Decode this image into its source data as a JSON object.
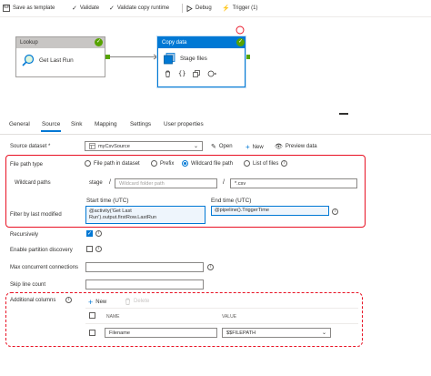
{
  "toolbar": {
    "save_template": "Save as template",
    "validate": "Validate",
    "validate_copy": "Validate copy runtime",
    "debug": "Debug",
    "trigger": "Trigger (1)"
  },
  "canvas": {
    "lookup": {
      "header": "Lookup",
      "name": "Get Last Run"
    },
    "copy": {
      "header": "Copy data",
      "name": "Stage files"
    }
  },
  "tabs": [
    "General",
    "Source",
    "Sink",
    "Mapping",
    "Settings",
    "User properties"
  ],
  "active_tab": "Source",
  "source": {
    "dataset_label": "Source dataset *",
    "dataset_value": "myCsvSource",
    "open": "Open",
    "new": "New",
    "preview": "Preview data",
    "file_path_type_label": "File path type",
    "file_path_options": [
      "File path in dataset",
      "Prefix",
      "Wildcard file path",
      "List of files"
    ],
    "file_path_selected": "Wildcard file path",
    "wildcard_label": "Wildcard paths",
    "wildcard_container": "stage",
    "wildcard_folder_placeholder": "Wildcard folder path",
    "wildcard_file": "*.csv",
    "start_time_label": "Start time (UTC)",
    "end_time_label": "End time (UTC)",
    "filter_label": "Filter by last modified",
    "start_time_value_1": "@activity('Get Last",
    "start_time_value_2": "Run').output.firstRow.LastRun",
    "end_time_value": "@pipeline().TriggerTime",
    "recursively_label": "Recursively",
    "recursively_checked": true,
    "partition_label": "Enable partition discovery",
    "max_conn_label": "Max concurrent connections",
    "skip_line_label": "Skip line count",
    "additional_columns_label": "Additional columns",
    "add_new": "New",
    "delete": "Delete",
    "col_name_header": "NAME",
    "col_value_header": "VALUE",
    "col_name": "Filename",
    "col_value": "$$FILEPATH"
  },
  "colors": {
    "accent": "#0078d4",
    "highlight": "#e81123",
    "success": "#57a300"
  }
}
